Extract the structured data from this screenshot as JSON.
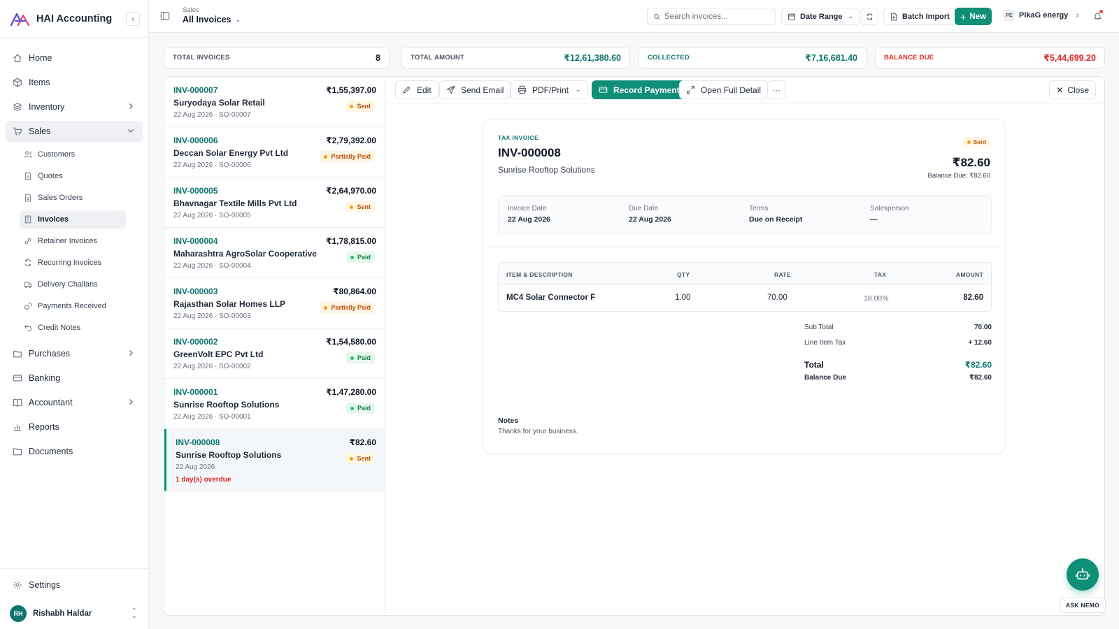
{
  "app": {
    "name": "HAI Accounting"
  },
  "sidebar": {
    "items": [
      {
        "label": "Home",
        "icon": "home-icon"
      },
      {
        "label": "Items",
        "icon": "box-icon"
      },
      {
        "label": "Inventory",
        "icon": "layers-icon"
      },
      {
        "label": "Sales",
        "icon": "cart-icon"
      }
    ],
    "sales_sub": [
      {
        "label": "Customers"
      },
      {
        "label": "Quotes"
      },
      {
        "label": "Sales Orders"
      },
      {
        "label": "Invoices"
      },
      {
        "label": "Retainer Invoices"
      },
      {
        "label": "Recurring Invoices"
      },
      {
        "label": "Delivery Challans"
      },
      {
        "label": "Payments Received"
      },
      {
        "label": "Credit Notes"
      }
    ],
    "items_after": [
      {
        "label": "Purchases"
      },
      {
        "label": "Banking"
      },
      {
        "label": "Accountant"
      },
      {
        "label": "Reports"
      },
      {
        "label": "Documents"
      }
    ],
    "settings": "Settings",
    "user": {
      "initials": "RH",
      "name": "Rishabh Haldar"
    }
  },
  "topbar": {
    "breadcrumb_parent": "Sales",
    "breadcrumb_current": "All Invoices",
    "search_placeholder": "Search invoices...",
    "date_range": "Date Range",
    "batch_import": "Batch Import",
    "new_label": "New",
    "org_initials": "PE",
    "org_name": "PikaG energy"
  },
  "stats": [
    {
      "label": "TOTAL INVOICES",
      "value": "8"
    },
    {
      "label": "TOTAL AMOUNT",
      "value": "₹12,61,380.60"
    },
    {
      "label": "COLLECTED",
      "value": "₹7,16,681.40"
    },
    {
      "label": "BALANCE DUE",
      "value": "₹5,44,699.20"
    }
  ],
  "invoices": [
    {
      "number": "INV-000007",
      "amount": "₹1,55,397.00",
      "customer": "Suryodaya Solar Retail",
      "meta": "22 Aug 2026 · SO-00007",
      "status": "Sent"
    },
    {
      "number": "INV-000006",
      "amount": "₹2,79,392.00",
      "customer": "Deccan Solar Energy Pvt Ltd",
      "meta": "22 Aug 2026 · SO-00006",
      "status": "Partially Paid"
    },
    {
      "number": "INV-000005",
      "amount": "₹2,64,970.00",
      "customer": "Bhavnagar Textile Mills Pvt Ltd",
      "meta": "22 Aug 2026 · SO-00005",
      "status": "Sent"
    },
    {
      "number": "INV-000004",
      "amount": "₹1,78,815.00",
      "customer": "Maharashtra AgroSolar Cooperative",
      "meta": "22 Aug 2026 · SO-00004",
      "status": "Paid"
    },
    {
      "number": "INV-000003",
      "amount": "₹80,864.00",
      "customer": "Rajasthan Solar Homes LLP",
      "meta": "22 Aug 2026 · SO-00003",
      "status": "Partially Paid"
    },
    {
      "number": "INV-000002",
      "amount": "₹1,54,580.00",
      "customer": "GreenVolt EPC Pvt Ltd",
      "meta": "22 Aug 2026 · SO-00002",
      "status": "Paid"
    },
    {
      "number": "INV-000001",
      "amount": "₹1,47,280.00",
      "customer": "Sunrise Rooftop Solutions",
      "meta": "22 Aug 2026 · SO-00001",
      "status": "Paid"
    },
    {
      "number": "INV-000008",
      "amount": "₹82.60",
      "customer": "Sunrise Rooftop Solutions",
      "meta": "22 Aug 2026",
      "status": "Sent",
      "overdue": "1 day(s) overdue"
    }
  ],
  "actions": {
    "edit": "Edit",
    "send_email": "Send Email",
    "pdf_print": "PDF/Print",
    "record_payment": "Record Payment",
    "open_full": "Open Full Detail",
    "more": "···",
    "close": "Close"
  },
  "detail": {
    "doc_type": "TAX INVOICE",
    "number": "INV-000008",
    "customer": "Sunrise Rooftop Solutions",
    "status": "Sent",
    "total": "₹82.60",
    "balance_line": "Balance Due: ₹82.60",
    "info": [
      {
        "label": "Invoice Date",
        "value": "22 Aug 2026"
      },
      {
        "label": "Due Date",
        "value": "22 Aug 2026"
      },
      {
        "label": "Terms",
        "value": "Due on Receipt"
      },
      {
        "label": "Salesperson",
        "value": "—"
      }
    ],
    "table_headers": {
      "item": "ITEM & DESCRIPTION",
      "qty": "QTY",
      "rate": "RATE",
      "tax": "TAX",
      "amount": "AMOUNT"
    },
    "line_items": [
      {
        "item": "MC4 Solar Connector F",
        "qty": "1.00",
        "rate": "70.00",
        "tax": "18.00%",
        "amount": "82.60"
      }
    ],
    "totals": {
      "sub_total_label": "Sub Total",
      "sub_total": "70.00",
      "line_tax_label": "Line Item Tax",
      "line_tax": "+ 12.60",
      "total_label": "Total",
      "total": "₹82.60",
      "balance_label": "Balance Due",
      "balance": "₹82.60"
    },
    "notes_label": "Notes",
    "notes": "Thanks for your business."
  },
  "assistant": {
    "label": "ASK NEMO"
  },
  "colors": {
    "accent": "#0f8f78",
    "accent_text": "#0f766e",
    "danger": "#dc2626",
    "warning": "#f59e0b",
    "success": "#22c55e"
  }
}
